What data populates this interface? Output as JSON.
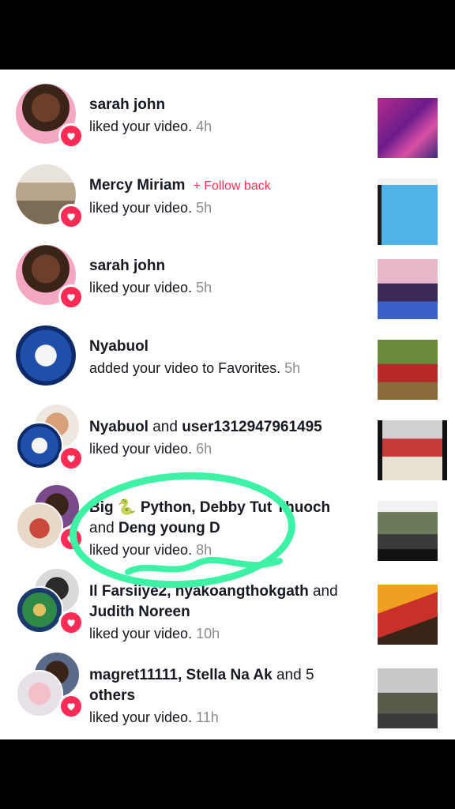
{
  "notifications": [
    {
      "name": "sarah john",
      "action": "liked your video.",
      "time": "4h"
    },
    {
      "name": "Mercy Miriam",
      "follow_back": "+ Follow back",
      "action": "liked your video.",
      "time": "5h"
    },
    {
      "name": "sarah john",
      "action": "liked your video.",
      "time": "5h"
    },
    {
      "name": "Nyabuol",
      "action": "added your video to Favorites.",
      "time": "5h"
    },
    {
      "name_a": "Nyabuol",
      "joiner": " and ",
      "name_b": "user1312947961495",
      "action": "liked your video.",
      "time": "6h"
    },
    {
      "line1": "Big 🐍 Python, Debby Tut Thuoch",
      "joiner": "and ",
      "name_c": "Deng young D",
      "action": "liked your video.",
      "time": "8h"
    },
    {
      "line1_a": "Il Farsiiye2, nyakoangthokgath",
      "line1_b": " and",
      "line2_name": "Judith Noreen",
      "action": "liked your video.",
      "time": "10h"
    },
    {
      "line1_a": "magret11111, Stella Na Ak",
      "line1_b": " and 5",
      "line2_name": "others",
      "action": "liked your video.",
      "time": "11h"
    }
  ],
  "colors": {
    "accent": "#fe2c55",
    "annotation": "#3df2a4"
  }
}
